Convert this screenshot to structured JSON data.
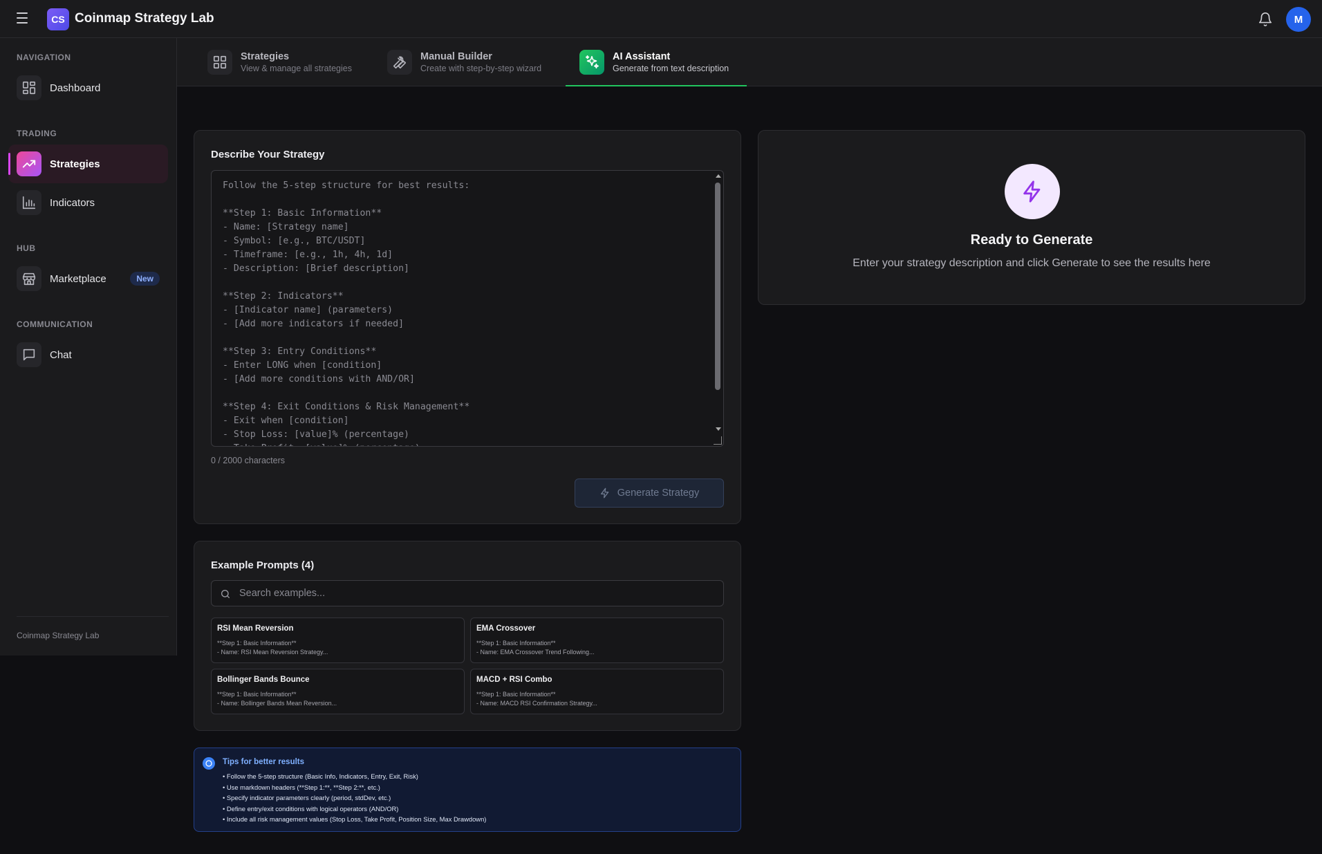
{
  "app": {
    "logo_initials": "CS",
    "title": "Coinmap Strategy Lab",
    "avatar_initial": "M",
    "icons": {
      "menu": "hamburger-icon",
      "notifications": "bell-icon"
    }
  },
  "sidebar": {
    "sections": [
      {
        "label": "NAVIGATION",
        "items": [
          {
            "label": "Dashboard",
            "icon": "grid-icon"
          }
        ]
      },
      {
        "label": "TRADING",
        "items": [
          {
            "label": "Strategies",
            "icon": "trending-up-icon",
            "active": true
          },
          {
            "label": "Indicators",
            "icon": "bar-chart-icon"
          }
        ]
      },
      {
        "label": "HUB",
        "items": [
          {
            "label": "Marketplace",
            "icon": "store-icon",
            "badge": "New"
          }
        ]
      },
      {
        "label": "COMMUNICATION",
        "items": [
          {
            "label": "Chat",
            "icon": "message-icon"
          }
        ]
      }
    ],
    "footer": "Coinmap Strategy Lab"
  },
  "tabs": [
    {
      "title": "Strategies",
      "subtitle": "View & manage all strategies",
      "icon": "grid-icon"
    },
    {
      "title": "Manual Builder",
      "subtitle": "Create with step-by-step wizard",
      "icon": "wrench-icon"
    },
    {
      "title": "AI Assistant",
      "subtitle": "Generate from text description",
      "icon": "sparkles-icon",
      "active": true
    }
  ],
  "describe": {
    "title": "Describe Your Strategy",
    "placeholder": "Follow the 5-step structure for best results:\n\n**Step 1: Basic Information**\n- Name: [Strategy name]\n- Symbol: [e.g., BTC/USDT]\n- Timeframe: [e.g., 1h, 4h, 1d]\n- Description: [Brief description]\n\n**Step 2: Indicators**\n- [Indicator name] (parameters)\n- [Add more indicators if needed]\n\n**Step 3: Entry Conditions**\n- Enter LONG when [condition]\n- [Add more conditions with AND/OR]\n\n**Step 4: Exit Conditions & Risk Management**\n- Exit when [condition]\n- Stop Loss: [value]% (percentage)\n- Take Profit: [value]% (percentage)",
    "char_count": "0 / 2000 characters",
    "generate_label": "Generate Strategy"
  },
  "examples": {
    "title": "Example Prompts (4)",
    "search_placeholder": "Search examples...",
    "items": [
      {
        "title": "RSI Mean Reversion",
        "line1": "**Step 1: Basic Information**",
        "line2": "- Name: RSI Mean Reversion Strategy..."
      },
      {
        "title": "EMA Crossover",
        "line1": "**Step 1: Basic Information**",
        "line2": "- Name: EMA Crossover Trend Following..."
      },
      {
        "title": "Bollinger Bands Bounce",
        "line1": "**Step 1: Basic Information**",
        "line2": "- Name: Bollinger Bands Mean Reversion..."
      },
      {
        "title": "MACD + RSI Combo",
        "line1": "**Step 1: Basic Information**",
        "line2": "- Name: MACD RSI Confirmation Strategy..."
      }
    ]
  },
  "tips": {
    "title": "Tips for better results",
    "items": [
      "Follow the 5-step structure (Basic Info, Indicators, Entry, Exit, Risk)",
      "Use markdown headers (**Step 1:**, **Step 2:**, etc.)",
      "Specify indicator parameters clearly (period, stdDev, etc.)",
      "Define entry/exit conditions with logical operators (AND/OR)",
      "Include all risk management values (Stop Loss, Take Profit, Position Size, Max Drawdown)"
    ]
  },
  "result": {
    "title": "Ready to Generate",
    "subtitle": "Enter your strategy description and click Generate to see the results here",
    "icon": "lightning-icon"
  },
  "colors": {
    "accent_active_nav": "#d946ef",
    "accent_active_tab": "#22c55e",
    "brand": "#4d4ae8",
    "avatar": "#2563eb",
    "tips_border": "#24408a"
  }
}
